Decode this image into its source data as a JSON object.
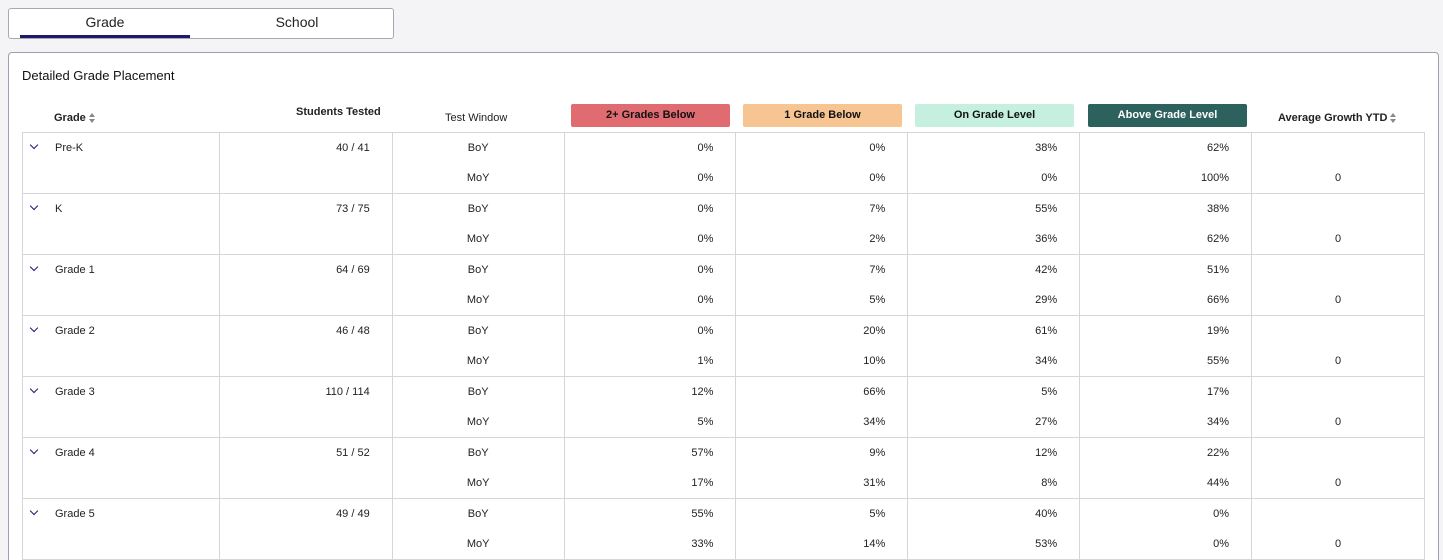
{
  "tabs": [
    {
      "label": "Grade",
      "active": true
    },
    {
      "label": "School",
      "active": false
    }
  ],
  "panel": {
    "title": "Detailed Grade Placement"
  },
  "headers": {
    "grade": "Grade",
    "students_tested": "Students Tested",
    "test_window": "Test Window",
    "below2": "2+ Grades Below",
    "below1": "1 Grade Below",
    "on_level": "On Grade Level",
    "above": "Above Grade Level",
    "growth": "Average Growth YTD"
  },
  "colors": {
    "below2": "#e06c72",
    "below1": "#f6c592",
    "on_level": "#c5f0e0",
    "above": "#2c615e",
    "accent": "#1c1a6e"
  },
  "rows": [
    {
      "grade": "Pre-K",
      "students": "40 / 41",
      "boy": {
        "window": "BoY",
        "below2": "0%",
        "below1": "0%",
        "on": "38%",
        "above": "62%",
        "growth": ""
      },
      "moy": {
        "window": "MoY",
        "below2": "0%",
        "below1": "0%",
        "on": "0%",
        "above": "100%",
        "growth": "0"
      }
    },
    {
      "grade": "K",
      "students": "73 / 75",
      "boy": {
        "window": "BoY",
        "below2": "0%",
        "below1": "7%",
        "on": "55%",
        "above": "38%",
        "growth": ""
      },
      "moy": {
        "window": "MoY",
        "below2": "0%",
        "below1": "2%",
        "on": "36%",
        "above": "62%",
        "growth": "0"
      }
    },
    {
      "grade": "Grade 1",
      "students": "64 / 69",
      "boy": {
        "window": "BoY",
        "below2": "0%",
        "below1": "7%",
        "on": "42%",
        "above": "51%",
        "growth": ""
      },
      "moy": {
        "window": "MoY",
        "below2": "0%",
        "below1": "5%",
        "on": "29%",
        "above": "66%",
        "growth": "0"
      }
    },
    {
      "grade": "Grade 2",
      "students": "46 / 48",
      "boy": {
        "window": "BoY",
        "below2": "0%",
        "below1": "20%",
        "on": "61%",
        "above": "19%",
        "growth": ""
      },
      "moy": {
        "window": "MoY",
        "below2": "1%",
        "below1": "10%",
        "on": "34%",
        "above": "55%",
        "growth": "0"
      }
    },
    {
      "grade": "Grade 3",
      "students": "110 / 114",
      "boy": {
        "window": "BoY",
        "below2": "12%",
        "below1": "66%",
        "on": "5%",
        "above": "17%",
        "growth": ""
      },
      "moy": {
        "window": "MoY",
        "below2": "5%",
        "below1": "34%",
        "on": "27%",
        "above": "34%",
        "growth": "0"
      }
    },
    {
      "grade": "Grade 4",
      "students": "51 / 52",
      "boy": {
        "window": "BoY",
        "below2": "57%",
        "below1": "9%",
        "on": "12%",
        "above": "22%",
        "growth": ""
      },
      "moy": {
        "window": "MoY",
        "below2": "17%",
        "below1": "31%",
        "on": "8%",
        "above": "44%",
        "growth": "0"
      }
    },
    {
      "grade": "Grade 5",
      "students": "49 / 49",
      "boy": {
        "window": "BoY",
        "below2": "55%",
        "below1": "5%",
        "on": "40%",
        "above": "0%",
        "growth": ""
      },
      "moy": {
        "window": "MoY",
        "below2": "33%",
        "below1": "14%",
        "on": "53%",
        "above": "0%",
        "growth": "0"
      }
    }
  ]
}
